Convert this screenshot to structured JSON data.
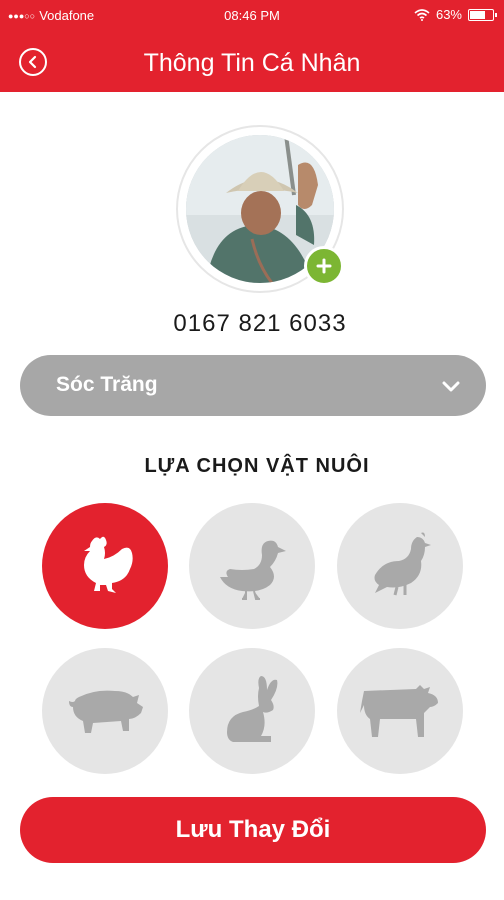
{
  "status_bar": {
    "carrier": "Vodafone",
    "time": "08:46 PM",
    "battery": "63%",
    "battery_level": 0.63
  },
  "header": {
    "title": "Thông Tin Cá Nhân",
    "back_icon": "back-circle-icon"
  },
  "profile": {
    "phone": "0167 821 6033",
    "add_photo_icon": "plus-icon"
  },
  "province": {
    "value": "Sóc Trăng",
    "icon": "chevron-down-icon"
  },
  "pets": {
    "title": "LỰA CHỌN VẬT NUÔI",
    "items": [
      {
        "name": "chicken",
        "icon": "chicken-icon",
        "selected": true
      },
      {
        "name": "duck",
        "icon": "duck-icon",
        "selected": false
      },
      {
        "name": "quail",
        "icon": "quail-icon",
        "selected": false
      },
      {
        "name": "pig",
        "icon": "pig-icon",
        "selected": false
      },
      {
        "name": "rabbit",
        "icon": "rabbit-icon",
        "selected": false
      },
      {
        "name": "cow",
        "icon": "cow-icon",
        "selected": false
      }
    ]
  },
  "actions": {
    "save_label": "Lưu Thay Đổi"
  },
  "colors": {
    "accent": "#e3222e",
    "disabled": "#a7a7a7",
    "unselected": "#e5e5e5",
    "add_green": "#7cb633"
  }
}
